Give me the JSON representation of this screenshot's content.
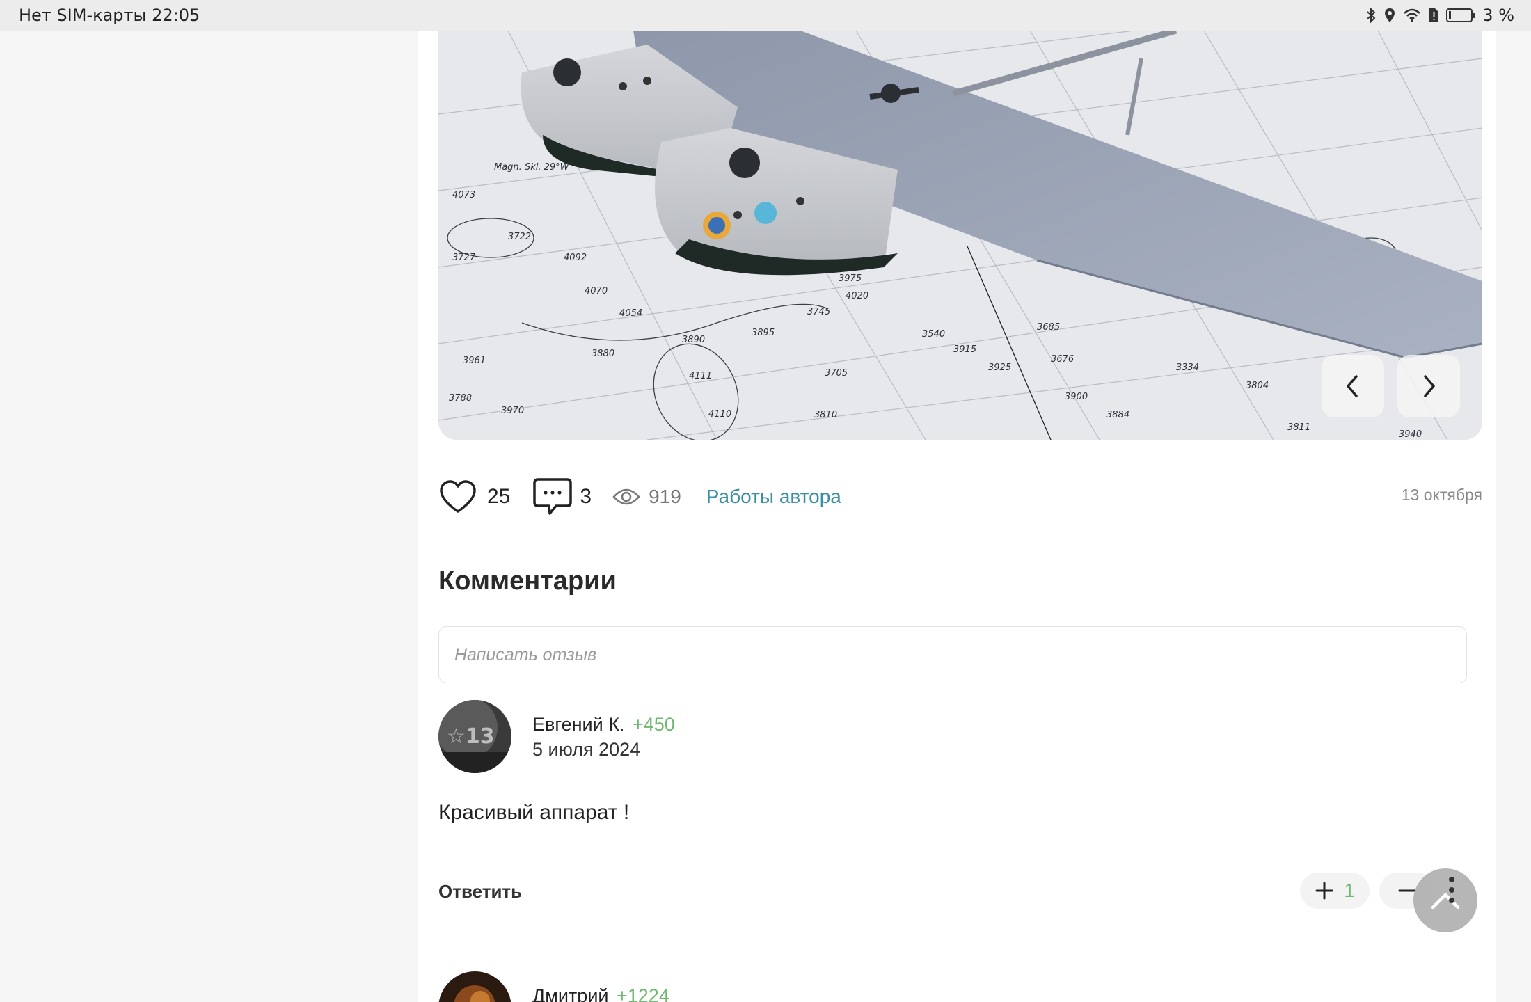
{
  "status_bar": {
    "left": "Нет SIM-карты 22:05",
    "battery": "3 %"
  },
  "post": {
    "likes": "25",
    "comments_count": "3",
    "views": "919",
    "author_works_link": "Работы автора",
    "date": "13 октября"
  },
  "comments_section": {
    "title": "Комментарии",
    "input_placeholder": "Написать отзыв"
  },
  "comments": [
    {
      "author": "Евгений К.",
      "rating": "+450",
      "date": "5 июля 2024",
      "text": "Красивый аппарат !",
      "reply_label": "Ответить",
      "votes": "1"
    },
    {
      "author": "Дмитрий",
      "rating": "+1224"
    }
  ],
  "icons": {
    "like": "heart-icon",
    "comment": "speech-bubble-icon",
    "views": "eye-icon",
    "prev": "chevron-left-icon",
    "next": "chevron-right-icon",
    "scroll_top": "chevron-up-icon",
    "menu": "vertical-dots-icon"
  },
  "colors": {
    "link": "#3a8fa3",
    "rating": "#6fb86f",
    "status_bar": "#ececec"
  }
}
